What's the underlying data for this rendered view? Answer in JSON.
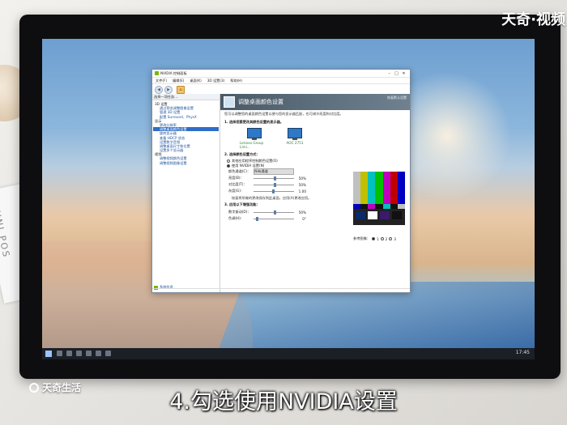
{
  "watermark": {
    "top": "天奇·视频",
    "bottom": "天奇生活"
  },
  "caption": "4.勾选使用NVIDIA设置",
  "window": {
    "title": "NVIDIA 控制面板",
    "menu": [
      "文件(F)",
      "编辑(E)",
      "桌面(K)",
      "3D 设置(3)",
      "帮助(H)"
    ],
    "toolbar": {
      "back": "后退",
      "forward": "前进",
      "home": "主页"
    },
    "left_header": "选择一项任务...",
    "tree": [
      {
        "text": "3D 设置",
        "level": 1
      },
      {
        "text": "通过预览调整图像设置",
        "level": 2
      },
      {
        "text": "管理 3D 设置",
        "level": 2
      },
      {
        "text": "配置 Surround、PhysX",
        "level": 2
      },
      {
        "text": "显示",
        "level": 1
      },
      {
        "text": "更改分辨率",
        "level": 2
      },
      {
        "text": "调整桌面颜色设置",
        "level": 2,
        "selected": true
      },
      {
        "text": "旋转显示器",
        "level": 2
      },
      {
        "text": "查看 HDCP 状态",
        "level": 2
      },
      {
        "text": "设置数字音频",
        "level": 2
      },
      {
        "text": "调整桌面尺寸和位置",
        "level": 2
      },
      {
        "text": "设置多个显示器",
        "level": 2
      },
      {
        "text": "视频",
        "level": 1
      },
      {
        "text": "调整视频颜色设置",
        "level": 2
      },
      {
        "text": "调整视频图像设置",
        "level": 2
      }
    ],
    "system_info": "系统信息",
    "banner_title": "调整桌面颜色设置",
    "restore": "恢复默认设置",
    "description": "您可以调整您的桌面颜色设置以便与您的显示器匹配，也可调节亮度和对比度。",
    "section1": "1. 选择您要更改其颜色设置的显示器。",
    "displays": [
      {
        "label": "Lenovo Group Limi..."
      },
      {
        "label": "AOC 2751"
      }
    ],
    "section2": "2. 选择颜色设置方式：",
    "radio_other": "其他应用程序控制颜色设置(O)",
    "radio_nvidia": "使用 NVIDIA 设置(N)",
    "channel_label": "颜色通道(C)：",
    "channel_value": "所有通道",
    "sliders": [
      {
        "label": "亮度(B)：",
        "value": "50%",
        "pos": 0.5
      },
      {
        "label": "对比度(T)：",
        "value": "50%",
        "pos": 0.5
      },
      {
        "label": "灰度(G)：",
        "value": "1.00",
        "pos": 0.45
      }
    ],
    "appl_note": "恢复将所做的更改保存到此桌面，应用(A)更改应用。",
    "section3": "3. 应用以下增强功能：",
    "sliders2": [
      {
        "label": "数字振动(D)：",
        "value": "50%",
        "pos": 0.5
      },
      {
        "label": "色调(H)：",
        "value": "0°",
        "pos": 0.05
      }
    ],
    "ref_label": "参考图像：",
    "radio_labels": [
      "1",
      "2",
      "3"
    ]
  },
  "taskbar": {
    "clock": "17:45"
  },
  "colors": {
    "selected": "#2f6ec8",
    "nvidia": "#76b900",
    "banner": "#4a5a67"
  }
}
